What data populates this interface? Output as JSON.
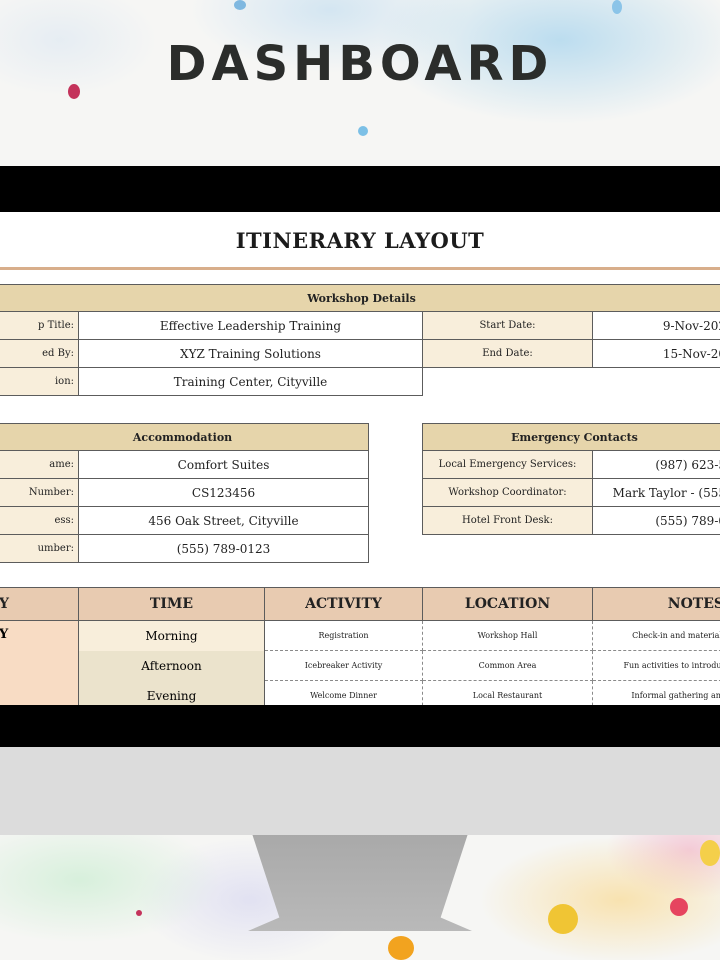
{
  "header": {
    "title": "DASHBOARD"
  },
  "sheet": {
    "title": "ITINERARY LAYOUT",
    "workshop": {
      "heading": "Workshop Details",
      "rows": [
        {
          "label": "p Title:",
          "value": "Effective Leadership Training",
          "label2": "Start Date:",
          "value2": "9-Nov-202"
        },
        {
          "label": "ed By:",
          "value": "XYZ Training Solutions",
          "label2": "End Date:",
          "value2": "15-Nov-20"
        },
        {
          "label": "ion:",
          "value": "Training Center, Cityville"
        }
      ]
    },
    "accommodation": {
      "heading": "Accommodation",
      "rows": [
        {
          "label": "ame:",
          "value": "Comfort Suites"
        },
        {
          "label": "Number:",
          "value": "CS123456"
        },
        {
          "label": "ess:",
          "value": "456 Oak Street, Cityville"
        },
        {
          "label": "umber:",
          "value": "(555) 789-0123"
        }
      ]
    },
    "emergency": {
      "heading": "Emergency Contacts",
      "rows": [
        {
          "label": "Local Emergency Services:",
          "value": "(987) 623-5"
        },
        {
          "label": "Workshop Coordinator:",
          "value": "Mark Taylor - (555"
        },
        {
          "label": "Hotel Front Desk:",
          "value": "(555) 789-0"
        }
      ]
    },
    "schedule": {
      "headers": {
        "day": "Y",
        "time": "TIME",
        "activity": "ACTIVITY",
        "location": "LOCATION",
        "notes": "NOTES"
      },
      "day_value": "Y",
      "rows": [
        {
          "time": "Morning",
          "activity": "Registration",
          "location": "Workshop Hall",
          "notes": "Check-in and materials"
        },
        {
          "time": "Afternoon",
          "activity": "Icebreaker Activity",
          "location": "Common Area",
          "notes": "Fun activities to introduc"
        },
        {
          "time": "Evening",
          "activity": "Welcome Dinner",
          "location": "Local Restaurant",
          "notes": "Informal gathering and"
        }
      ]
    }
  },
  "colors": {
    "section_header": "#e6d5ab",
    "label_fill": "#f8eedb",
    "schedule_header": "#e8cbb1",
    "day_fill": "#f8dcc4",
    "title_rule": "#d8ae8b"
  }
}
